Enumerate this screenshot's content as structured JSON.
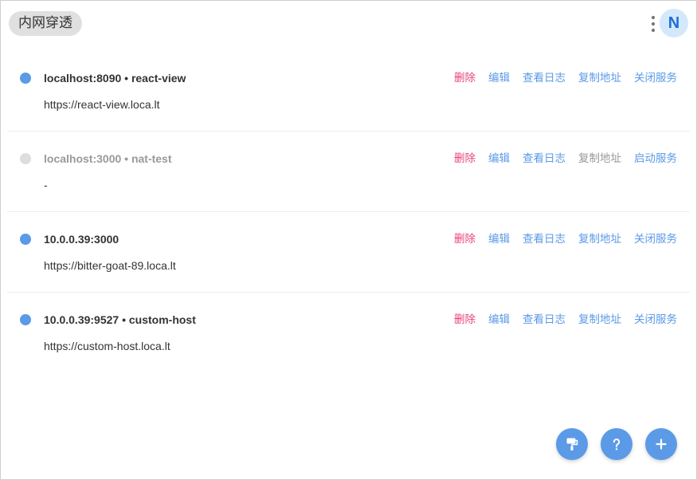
{
  "header": {
    "title": "内网穿透",
    "avatar_letter": "N"
  },
  "icons": {
    "more": "more-vertical-icon",
    "fab_theme": "paint-roller-icon",
    "fab_help": "help-icon",
    "fab_add": "add-icon"
  },
  "colors": {
    "accent": "#5b9ae6",
    "danger": "#e6447b",
    "inactive": "#dddddd",
    "muted_text": "#999999",
    "avatar_bg": "#d4e8fb",
    "avatar_fg": "#1a6fd6"
  },
  "tunnels": [
    {
      "active": true,
      "copy_enabled": true,
      "title": "localhost:8090 • react-view",
      "url": "https://react-view.loca.lt",
      "actions": {
        "delete": "删除",
        "edit": "编辑",
        "logs": "查看日志",
        "copy": "复制地址",
        "toggle": "关闭服务"
      }
    },
    {
      "active": false,
      "copy_enabled": false,
      "title": "localhost:3000 • nat-test",
      "url": "-",
      "actions": {
        "delete": "删除",
        "edit": "编辑",
        "logs": "查看日志",
        "copy": "复制地址",
        "toggle": "启动服务"
      }
    },
    {
      "active": true,
      "copy_enabled": true,
      "title": "10.0.0.39:3000",
      "url": "https://bitter-goat-89.loca.lt",
      "actions": {
        "delete": "删除",
        "edit": "编辑",
        "logs": "查看日志",
        "copy": "复制地址",
        "toggle": "关闭服务"
      }
    },
    {
      "active": true,
      "copy_enabled": true,
      "title": "10.0.0.39:9527 • custom-host",
      "url": "https://custom-host.loca.lt",
      "actions": {
        "delete": "删除",
        "edit": "编辑",
        "logs": "查看日志",
        "copy": "复制地址",
        "toggle": "关闭服务"
      }
    }
  ]
}
